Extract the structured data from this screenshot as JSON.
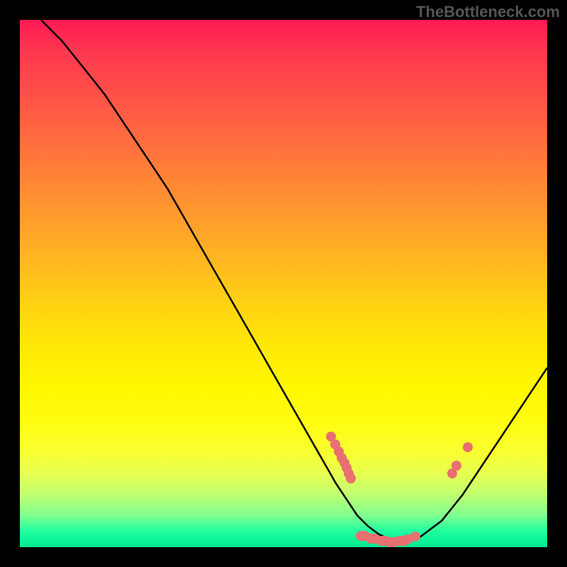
{
  "watermark": "TheBottleneck.com",
  "chart_data": {
    "type": "line",
    "title": "",
    "xlabel": "",
    "ylabel": "",
    "xlim": [
      0,
      100
    ],
    "ylim": [
      0,
      100
    ],
    "series": [
      {
        "name": "curve",
        "x": [
          4,
          8,
          12,
          16,
          20,
          24,
          28,
          32,
          36,
          40,
          44,
          48,
          52,
          56,
          60,
          62,
          64,
          66,
          68,
          70,
          72,
          74,
          76,
          80,
          84,
          88,
          92,
          96,
          100
        ],
        "y": [
          100,
          96,
          91,
          86,
          80,
          74,
          68,
          61,
          54,
          47,
          40,
          33,
          26,
          19,
          12,
          9,
          6,
          4,
          2.5,
          1.5,
          1,
          1.2,
          2,
          5,
          10,
          16,
          22,
          28,
          34
        ]
      }
    ],
    "notes": "V-shaped bottleneck curve; minimum around x≈72. Salmon dots mark highlighted sample points along the curve.",
    "dots": [
      {
        "x": 59,
        "y": 21
      },
      {
        "x": 59.8,
        "y": 19.5
      },
      {
        "x": 60.5,
        "y": 18.2
      },
      {
        "x": 61,
        "y": 17
      },
      {
        "x": 61.5,
        "y": 16
      },
      {
        "x": 62,
        "y": 15
      },
      {
        "x": 62.4,
        "y": 14
      },
      {
        "x": 62.8,
        "y": 13
      },
      {
        "x": 65,
        "y": 2.2,
        "wide": true
      },
      {
        "x": 67,
        "y": 1.6,
        "wide": true
      },
      {
        "x": 69,
        "y": 1.2,
        "wide": true
      },
      {
        "x": 70.5,
        "y": 1,
        "wide": true
      },
      {
        "x": 72.5,
        "y": 1.2,
        "wide": true
      },
      {
        "x": 73.5,
        "y": 1.5
      },
      {
        "x": 75,
        "y": 2
      },
      {
        "x": 82,
        "y": 14
      },
      {
        "x": 82.8,
        "y": 15.5
      },
      {
        "x": 85,
        "y": 19
      }
    ]
  }
}
